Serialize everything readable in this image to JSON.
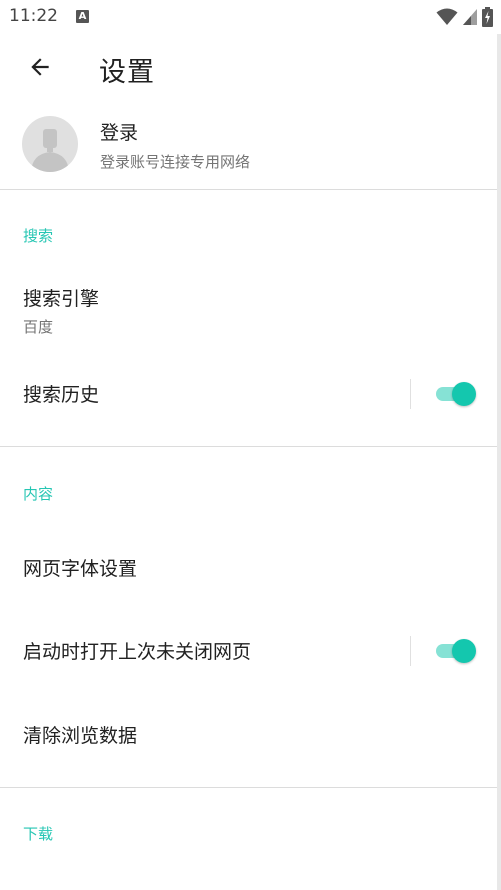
{
  "status_bar": {
    "time": "11:22",
    "notification_icon_letter": "A",
    "icons": [
      "wifi-icon",
      "signal-icon",
      "battery-charging-icon"
    ]
  },
  "app_bar": {
    "back_icon": "arrow-left-icon",
    "title": "设置"
  },
  "account": {
    "avatar_icon": "person-icon",
    "title": "登录",
    "subtitle": "登录账号连接专用网络"
  },
  "sections": {
    "search": {
      "header": "搜索",
      "engine_label": "搜索引擎",
      "engine_value": "百度",
      "history_label": "搜索历史",
      "history_enabled": true
    },
    "content": {
      "header": "内容",
      "font_label": "网页字体设置",
      "restore_label": "启动时打开上次未关闭网页",
      "restore_enabled": true,
      "clear_label": "清除浏览数据"
    },
    "download": {
      "header": "下载"
    }
  },
  "colors": {
    "accent": "#26c6b3",
    "toggle_thumb": "#14c7ae",
    "toggle_track": "#86e2d5",
    "divider": "#dcdcdc"
  }
}
